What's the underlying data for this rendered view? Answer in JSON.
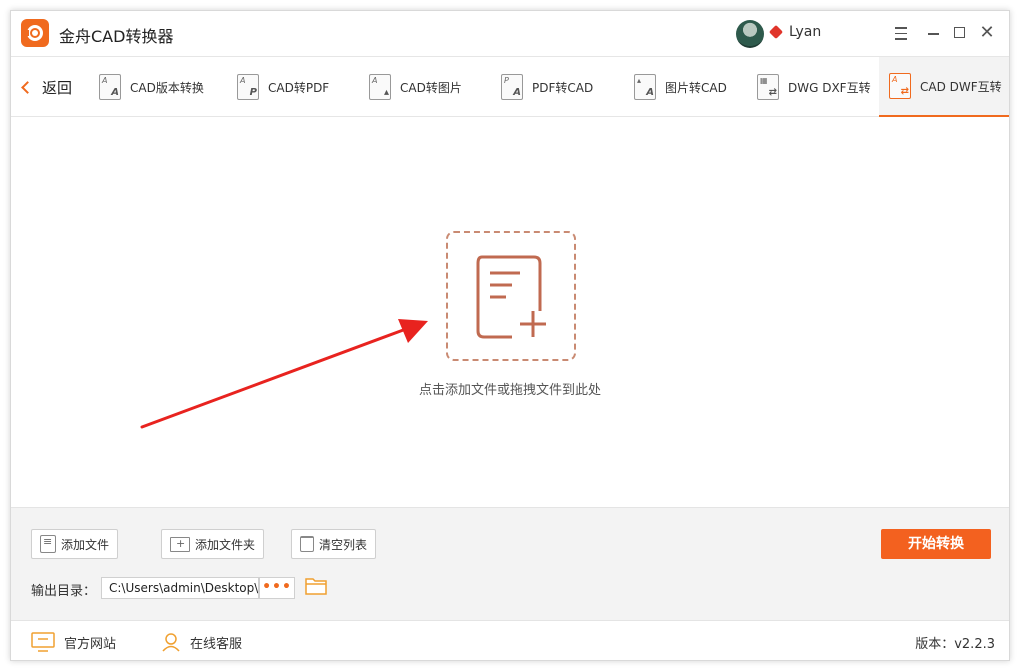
{
  "app": {
    "title": "金舟CAD转换器",
    "accent_color": "#f06a1e",
    "user": {
      "name": "Lyan",
      "vip_icon": "vip-diamond-icon"
    }
  },
  "toolbar": {
    "back_label": "返回",
    "tabs": [
      {
        "label": "CAD版本转换",
        "icon": "cad-version-icon",
        "g1": "A",
        "g2": "A"
      },
      {
        "label": "CAD转PDF",
        "icon": "cad-to-pdf-icon",
        "g1": "A",
        "g2": "P"
      },
      {
        "label": "CAD转图片",
        "icon": "cad-to-image-icon",
        "g1": "A",
        "g2": "▴"
      },
      {
        "label": "PDF转CAD",
        "icon": "pdf-to-cad-icon",
        "g1": "P",
        "g2": "A"
      },
      {
        "label": "图片转CAD",
        "icon": "image-to-cad-icon",
        "g1": "▴",
        "g2": "A"
      },
      {
        "label": "DWG DXF互转",
        "icon": "dwg-dxf-icon",
        "g1": "▦",
        "g2": "⇄"
      },
      {
        "label": "CAD DWF互转",
        "icon": "cad-dwf-icon",
        "g1": "A",
        "g2": "⇄"
      }
    ],
    "active_tab": 6
  },
  "dropzone": {
    "hint": "点击添加文件或拖拽文件到此处",
    "icon": "add-document-icon"
  },
  "bottom": {
    "add_file_label": "添加文件",
    "add_folder_label": "添加文件夹",
    "clear_list_label": "清空列表",
    "start_label": "开始转换",
    "output_label": "输出目录：",
    "output_path": "C:\\Users\\admin\\Desktop\\",
    "more_label": "•••"
  },
  "statusbar": {
    "website_label": "官方网站",
    "support_label": "在线客服",
    "version_label": "版本：",
    "version_value": "v2.2.3"
  }
}
